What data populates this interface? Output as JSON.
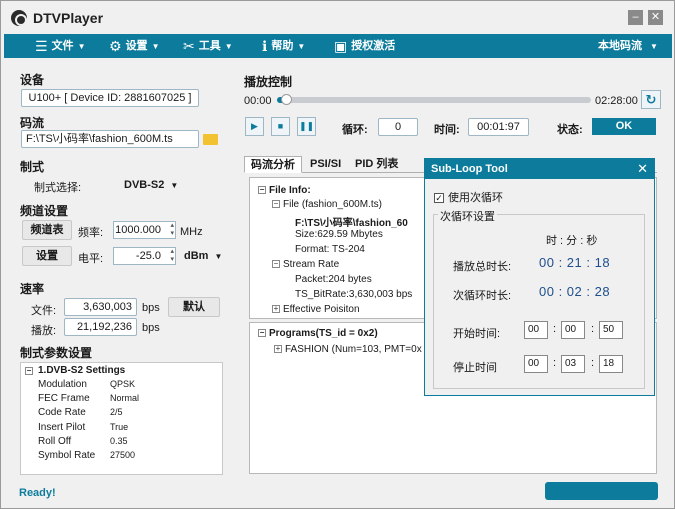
{
  "app": {
    "title": "DTVPlayer",
    "status": "Ready!"
  },
  "menubar": {
    "file": "文件",
    "settings": "设置",
    "tools": "工具",
    "help": "帮助",
    "activate": "授权激活",
    "source": "本地码流"
  },
  "device": {
    "label": "设备",
    "value": "U100+ [ Device ID: 2881607025 ]"
  },
  "stream": {
    "label": "码流",
    "value": "F:\\TS\\小码率\\fashion_600M.ts"
  },
  "standard": {
    "label": "制式",
    "select_label": "制式选择:",
    "select_value": "DVB-S2"
  },
  "channel": {
    "label": "频道设置",
    "table_btn": "频道表",
    "freq_label": "频率:",
    "freq_value": "1000.000",
    "freq_unit": "MHz",
    "set_btn": "设置",
    "level_label": "电平:",
    "level_value": "-25.0",
    "level_unit": "dBm"
  },
  "rate": {
    "label": "速率",
    "file_label": "文件:",
    "file_value": "3,630,003",
    "play_label": "播放:",
    "play_value": "21,192,236",
    "unit": "bps",
    "default_btn": "默认"
  },
  "params": {
    "label": "制式参数设置",
    "group": "1.DVB-S2 Settings",
    "rows": [
      {
        "k": "Modulation",
        "v": "QPSK"
      },
      {
        "k": "FEC Frame",
        "v": "Normal"
      },
      {
        "k": "Code Rate",
        "v": "2/5"
      },
      {
        "k": "Insert Pilot",
        "v": "True"
      },
      {
        "k": "Roll Off",
        "v": "0.35"
      },
      {
        "k": "Symbol Rate",
        "v": "27500"
      }
    ]
  },
  "playback": {
    "label": "播放控制",
    "time_start": "00:00",
    "time_end": "02:28:00",
    "progress": 0.03,
    "loop_label": "循环:",
    "loop_value": "0",
    "time_label": "时间:",
    "time_value": "00:01:97",
    "state_label": "状态:",
    "state_value": "OK"
  },
  "tabs": {
    "t1": "码流分析",
    "t2": "PSI/SI",
    "t3": "PID 列表"
  },
  "tree1": {
    "root": "File Info:",
    "file": "File (fashion_600M.ts)",
    "path": "F:\\TS\\小码率\\fashion_60",
    "size": "Size:629.59 Mbytes",
    "format": "Format: TS-204",
    "stream_rate": "Stream Rate",
    "packet": "Packet:204 bytes",
    "bitrate": "TS_BitRate:3,630,003 bps",
    "effective": "Effective Poisiton"
  },
  "tree2": {
    "root": "Programs(TS_id = 0x2)",
    "prog": "FASHION (Num=103, PMT=0x"
  },
  "dialog": {
    "title": "Sub-Loop Tool",
    "use_loop": "使用次循环",
    "group": "次循环设置",
    "hms": "时 : 分 : 秒",
    "total_label": "播放总时长:",
    "total_value": "00 : 21 : 18",
    "loop_len_label": "次循环时长:",
    "loop_len_value": "00 : 02 : 28",
    "start_label": "开始时间:",
    "start": [
      "00",
      "00",
      "50"
    ],
    "stop_label": "停止时间",
    "stop": [
      "00",
      "03",
      "18"
    ]
  }
}
